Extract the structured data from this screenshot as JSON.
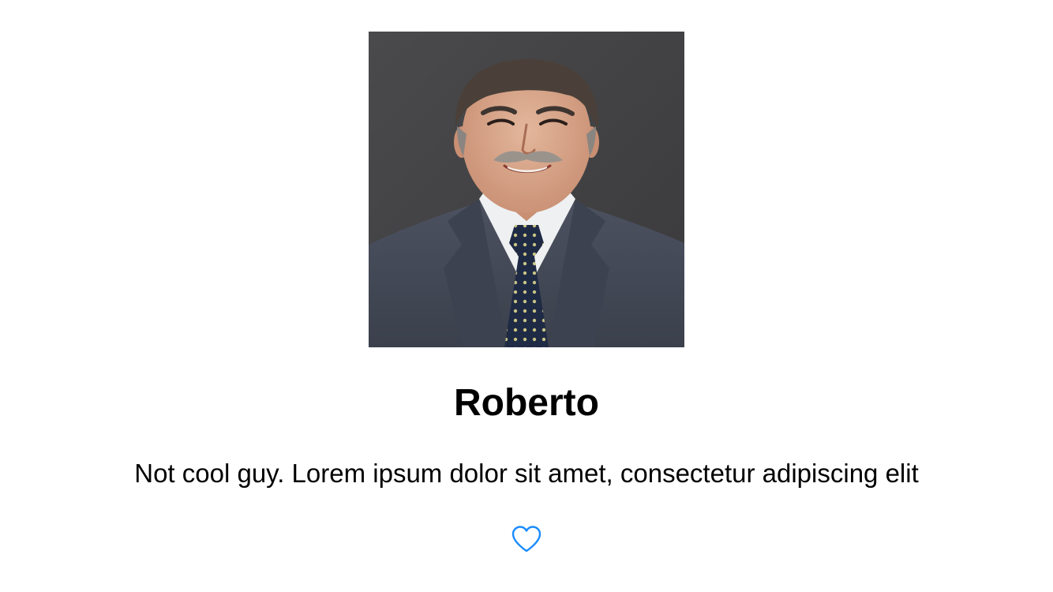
{
  "profile": {
    "name": "Roberto",
    "description": "Not cool guy. Lorem ipsum dolor sit amet, consectetur adipiscing elit"
  },
  "photo": {
    "subject": "portrait of a man in a dark suit and tie"
  },
  "like_button": {
    "icon": "heart-outline-icon",
    "color": "#1a8cff"
  }
}
